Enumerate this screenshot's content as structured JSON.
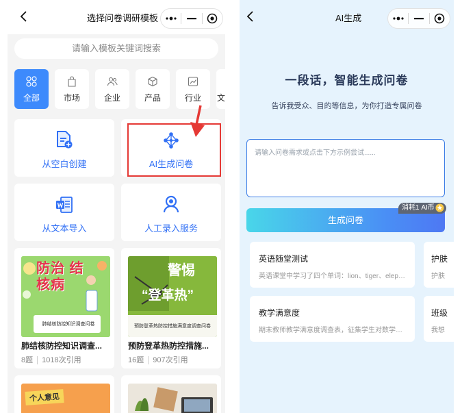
{
  "left": {
    "title": "选择问卷调研模板",
    "search_placeholder": "请输入模板关键词搜索",
    "categories": [
      {
        "label": "全部",
        "icon": "grid-icon",
        "active": true
      },
      {
        "label": "市场",
        "icon": "bag-icon"
      },
      {
        "label": "企业",
        "icon": "people-icon"
      },
      {
        "label": "产品",
        "icon": "box-icon"
      },
      {
        "label": "行业",
        "icon": "chart-icon"
      },
      {
        "label": "文"
      }
    ],
    "create_options": [
      {
        "label": "从空白创建",
        "icon": "blank-doc-icon"
      },
      {
        "label": "AI生成问卷",
        "icon": "ai-network-icon"
      },
      {
        "label": "从文本导入",
        "icon": "word-doc-icon"
      },
      {
        "label": "人工录入服务",
        "icon": "person-service-icon"
      }
    ],
    "templates": [
      {
        "name": "肺结核防控知识调查...",
        "questions": "8题",
        "uses": "1018次引用",
        "thumb_big": "防治 结核病",
        "thumb_caption": "肺结核防控知识调查问卷"
      },
      {
        "name": "预防登革热防控措施...",
        "questions": "16题",
        "uses": "907次引用",
        "thumb_big_1": "警惕",
        "thumb_big_2": "“登革热”",
        "thumb_caption": "预防登革热防控措施满意度调查问卷"
      }
    ],
    "bottom_card_text": "个人意见"
  },
  "right": {
    "title": "AI生成",
    "hero": "一段话，智能生成问卷",
    "subtitle": "告诉我受众、目的等信息，为你打造专属问卷",
    "input_placeholder": "请输入问卷需求或点击下方示例尝试......",
    "generate_label": "生成问卷",
    "cost_badge": "消耗1 AI币",
    "examples": [
      {
        "title": "英语随堂测试",
        "desc": "英语课堂中学习了四个单词：lion、tiger、elephant"
      },
      {
        "title": "护肤",
        "desc": "护肤"
      },
      {
        "title": "教学满意度",
        "desc": "期末教师教学满意度调查表，征集学生对数学老师的意见"
      },
      {
        "title": "班级",
        "desc": "我想"
      }
    ]
  },
  "colors": {
    "accent": "#3d8afc",
    "link": "#3170f5",
    "highlight": "#e53935",
    "right_bg": "#e6f3fd"
  }
}
